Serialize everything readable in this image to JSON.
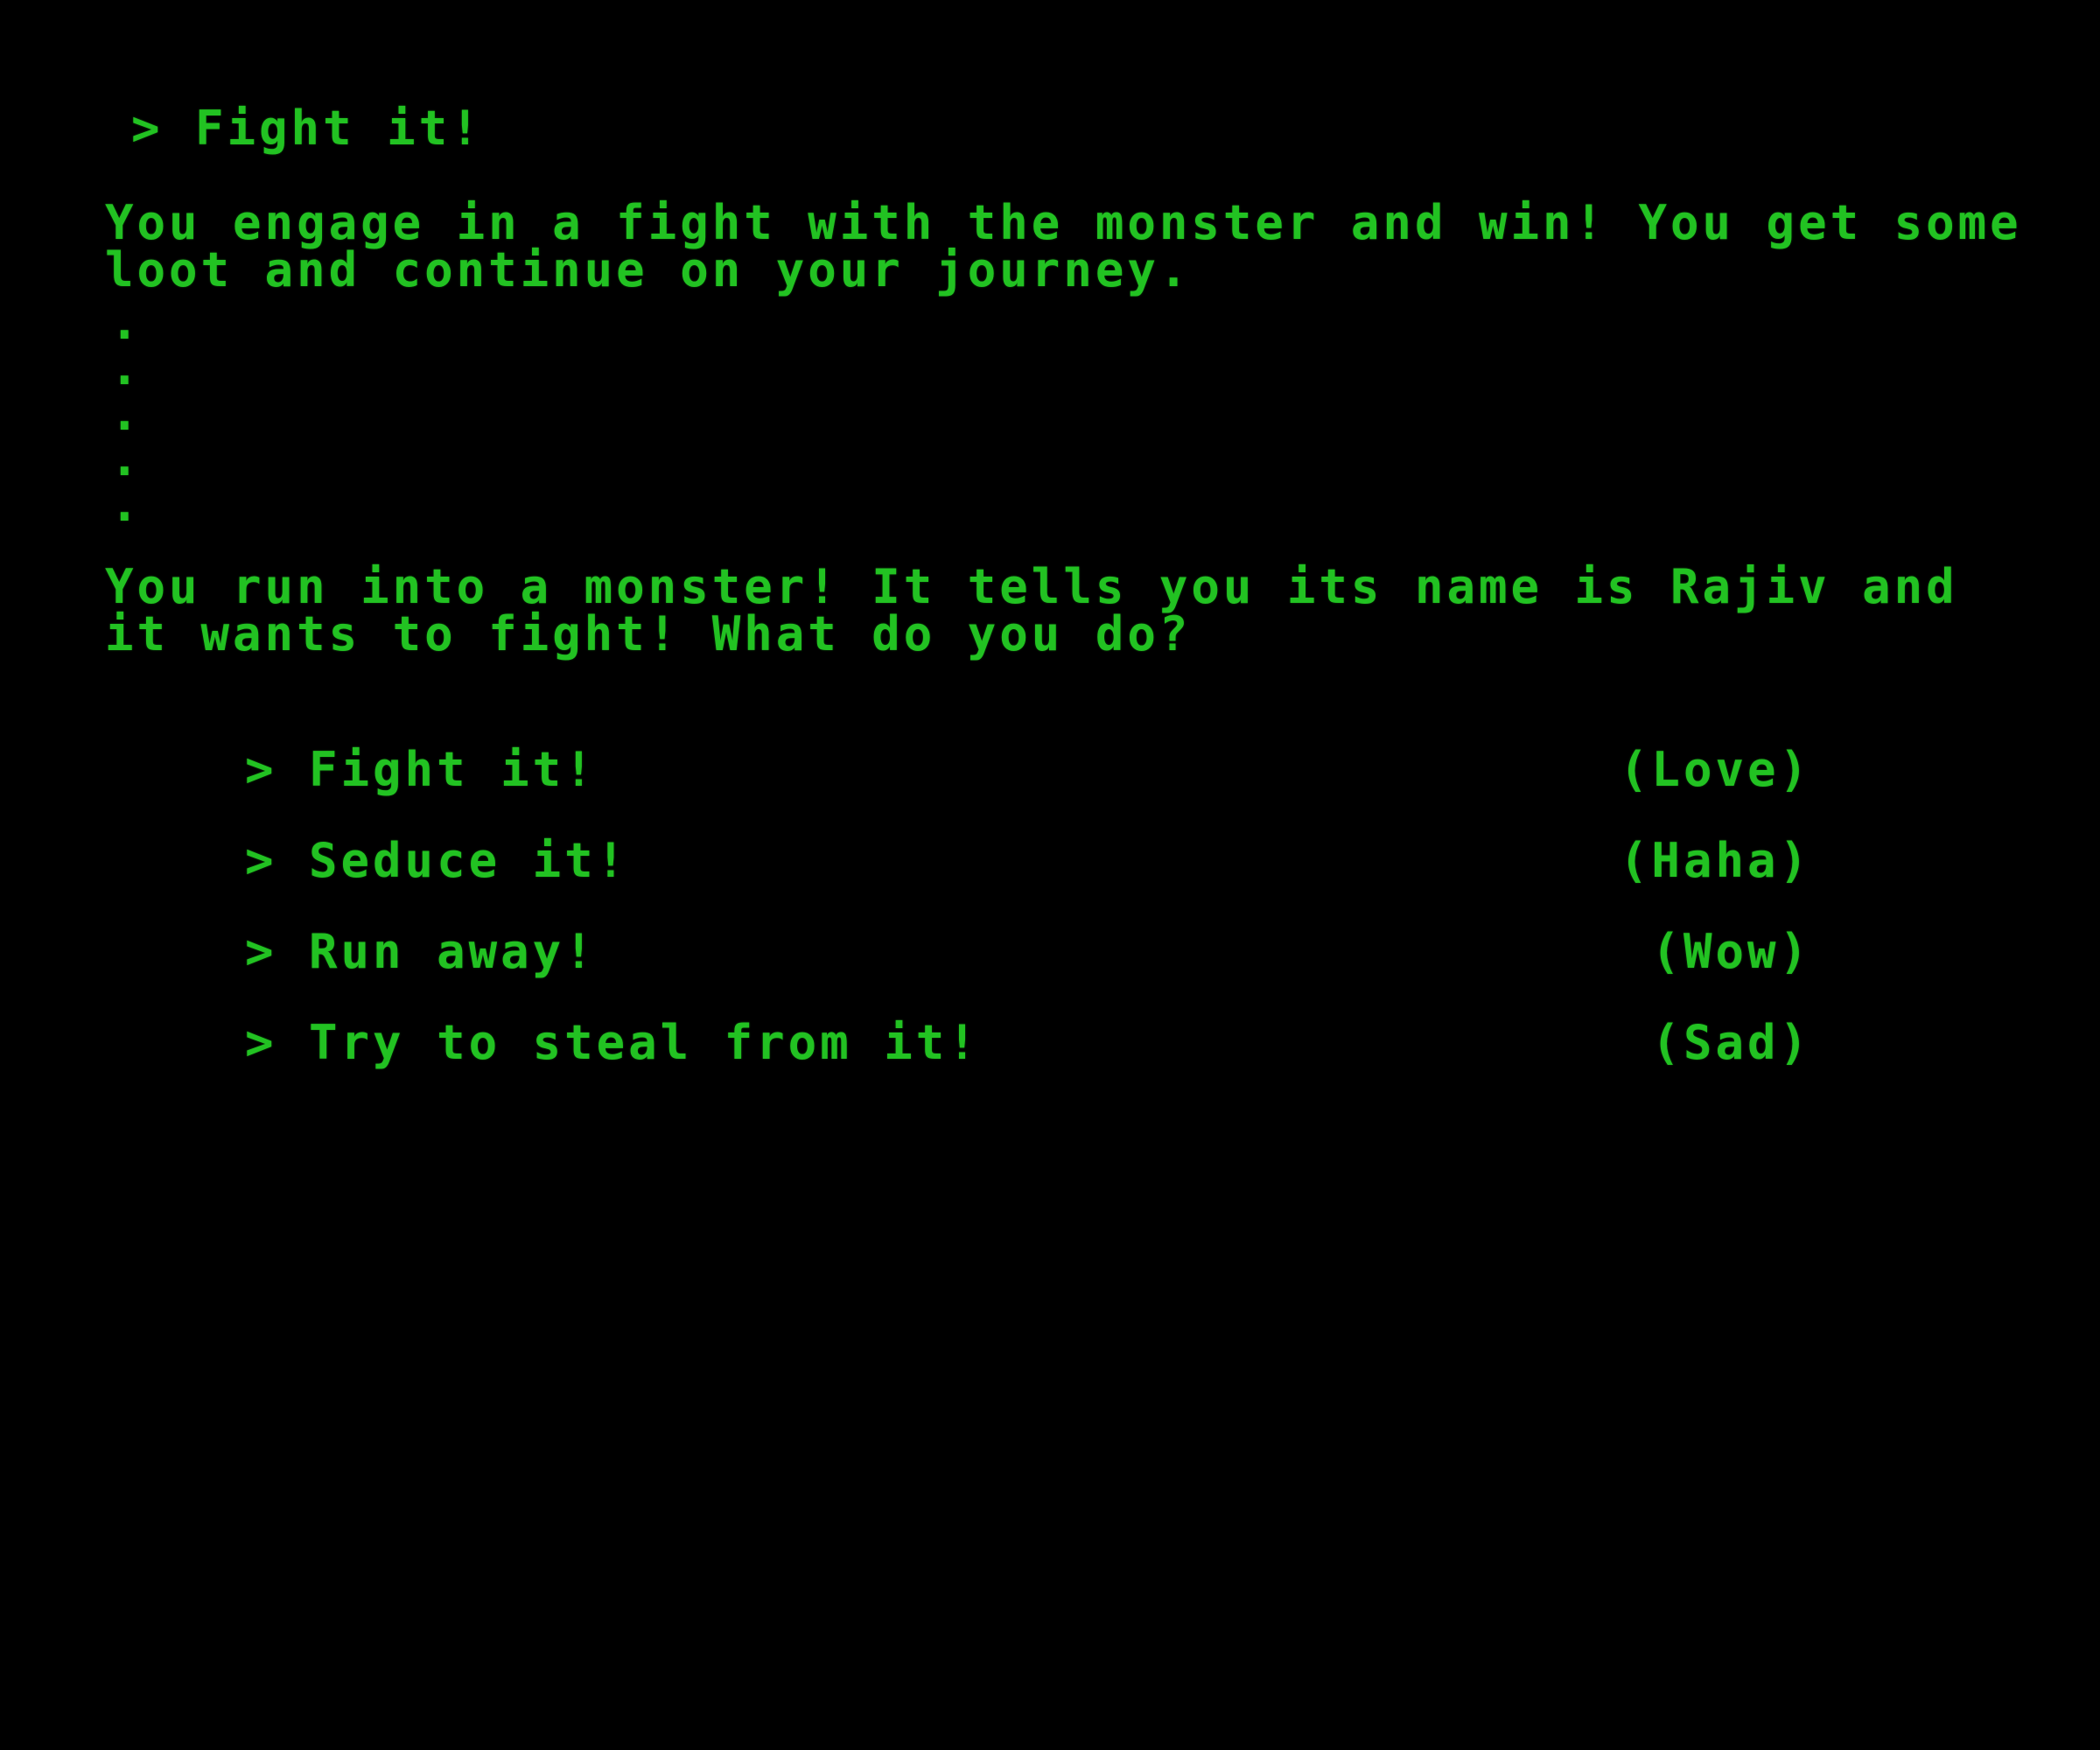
{
  "history": {
    "previous_choice": "> Fight it!",
    "result_text": "You engage in a fight with the monster and win! You get some loot and continue on your journey.",
    "ellipsis": [
      ".",
      ".",
      ".",
      ".",
      "."
    ]
  },
  "encounter": {
    "prompt_text": "You run into a monster! It tells you its name is Rajiv and it wants to fight! What do you do?"
  },
  "choices": [
    {
      "label": "> Fight it!",
      "reaction": "(Love)"
    },
    {
      "label": "> Seduce it!",
      "reaction": "(Haha)"
    },
    {
      "label": "> Run away!",
      "reaction": "(Wow)"
    },
    {
      "label": "> Try to steal from it!",
      "reaction": "(Sad)"
    }
  ],
  "colors": {
    "background": "#000000",
    "text": "#22c222"
  }
}
